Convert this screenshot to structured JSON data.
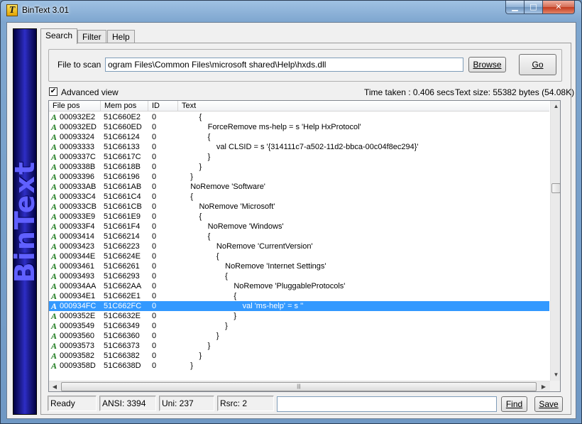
{
  "window": {
    "title": "BinText 3.01",
    "app_icon_glyph": "T"
  },
  "caption_buttons": {
    "minimize": "▁",
    "maximize": "□",
    "close": "✕"
  },
  "brand": {
    "text": "BinText"
  },
  "tabs": [
    {
      "label": "Search",
      "active": true
    },
    {
      "label": "Filter",
      "active": false
    },
    {
      "label": "Help",
      "active": false
    }
  ],
  "scan": {
    "label": "File to scan",
    "value": "ogram Files\\Common Files\\microsoft shared\\Help\\hxds.dll",
    "browse_label": "Browse",
    "go_label": "Go"
  },
  "options": {
    "advanced_view_label": "Advanced view",
    "advanced_view_checked": true,
    "check_glyph": "✔",
    "time_taken": "Time taken : 0.406 secs",
    "text_size": "Text size: 55382 bytes (54.08K)"
  },
  "table": {
    "columns": [
      "File pos",
      "Mem pos",
      "ID",
      "Text"
    ],
    "type_glyph": "A",
    "rows": [
      {
        "file_pos": "000932E2",
        "mem_pos": "51C660E2",
        "id": "0",
        "text": "        {"
      },
      {
        "file_pos": "000932ED",
        "mem_pos": "51C660ED",
        "id": "0",
        "text": "            ForceRemove ms-help = s 'Help HxProtocol'"
      },
      {
        "file_pos": "00093324",
        "mem_pos": "51C66124",
        "id": "0",
        "text": "            {"
      },
      {
        "file_pos": "00093333",
        "mem_pos": "51C66133",
        "id": "0",
        "text": "                val CLSID = s '{314111c7-a502-11d2-bbca-00c04f8ec294}'"
      },
      {
        "file_pos": "0009337C",
        "mem_pos": "51C6617C",
        "id": "0",
        "text": "            }"
      },
      {
        "file_pos": "0009338B",
        "mem_pos": "51C6618B",
        "id": "0",
        "text": "        }"
      },
      {
        "file_pos": "00093396",
        "mem_pos": "51C66196",
        "id": "0",
        "text": "    }"
      },
      {
        "file_pos": "000933AB",
        "mem_pos": "51C661AB",
        "id": "0",
        "text": "    NoRemove 'Software'"
      },
      {
        "file_pos": "000933C4",
        "mem_pos": "51C661C4",
        "id": "0",
        "text": "    {"
      },
      {
        "file_pos": "000933CB",
        "mem_pos": "51C661CB",
        "id": "0",
        "text": "        NoRemove 'Microsoft'"
      },
      {
        "file_pos": "000933E9",
        "mem_pos": "51C661E9",
        "id": "0",
        "text": "        {"
      },
      {
        "file_pos": "000933F4",
        "mem_pos": "51C661F4",
        "id": "0",
        "text": "            NoRemove 'Windows'"
      },
      {
        "file_pos": "00093414",
        "mem_pos": "51C66214",
        "id": "0",
        "text": "            {"
      },
      {
        "file_pos": "00093423",
        "mem_pos": "51C66223",
        "id": "0",
        "text": "                NoRemove 'CurrentVersion'"
      },
      {
        "file_pos": "0009344E",
        "mem_pos": "51C6624E",
        "id": "0",
        "text": "                {"
      },
      {
        "file_pos": "00093461",
        "mem_pos": "51C66261",
        "id": "0",
        "text": "                    NoRemove 'Internet Settings'"
      },
      {
        "file_pos": "00093493",
        "mem_pos": "51C66293",
        "id": "0",
        "text": "                    {"
      },
      {
        "file_pos": "000934AA",
        "mem_pos": "51C662AA",
        "id": "0",
        "text": "                        NoRemove 'PluggableProtocols'"
      },
      {
        "file_pos": "000934E1",
        "mem_pos": "51C662E1",
        "id": "0",
        "text": "                        {"
      },
      {
        "file_pos": "000934FC",
        "mem_pos": "51C662FC",
        "id": "0",
        "text": "                            val 'ms-help' = s ''",
        "selected": true
      },
      {
        "file_pos": "0009352E",
        "mem_pos": "51C6632E",
        "id": "0",
        "text": "                        }"
      },
      {
        "file_pos": "00093549",
        "mem_pos": "51C66349",
        "id": "0",
        "text": "                    }"
      },
      {
        "file_pos": "00093560",
        "mem_pos": "51C66360",
        "id": "0",
        "text": "                }"
      },
      {
        "file_pos": "00093573",
        "mem_pos": "51C66373",
        "id": "0",
        "text": "            }"
      },
      {
        "file_pos": "00093582",
        "mem_pos": "51C66382",
        "id": "0",
        "text": "        }"
      },
      {
        "file_pos": "0009358D",
        "mem_pos": "51C6638D",
        "id": "0",
        "text": "    }"
      }
    ]
  },
  "scrollbar": {
    "up": "▲",
    "down": "▼",
    "left": "◀",
    "right": "▶",
    "grip": "|||"
  },
  "status": {
    "state": "Ready",
    "ansi": "ANSI: 3394",
    "uni": "Uni: 237",
    "rsrc": "Rsrc: 2",
    "find_label": "Find",
    "find_value": "",
    "save_label": "Save"
  },
  "colors": {
    "selection": "#3399ff",
    "brand": "#2d2dc6",
    "type_icon": "#1b7a1b"
  }
}
